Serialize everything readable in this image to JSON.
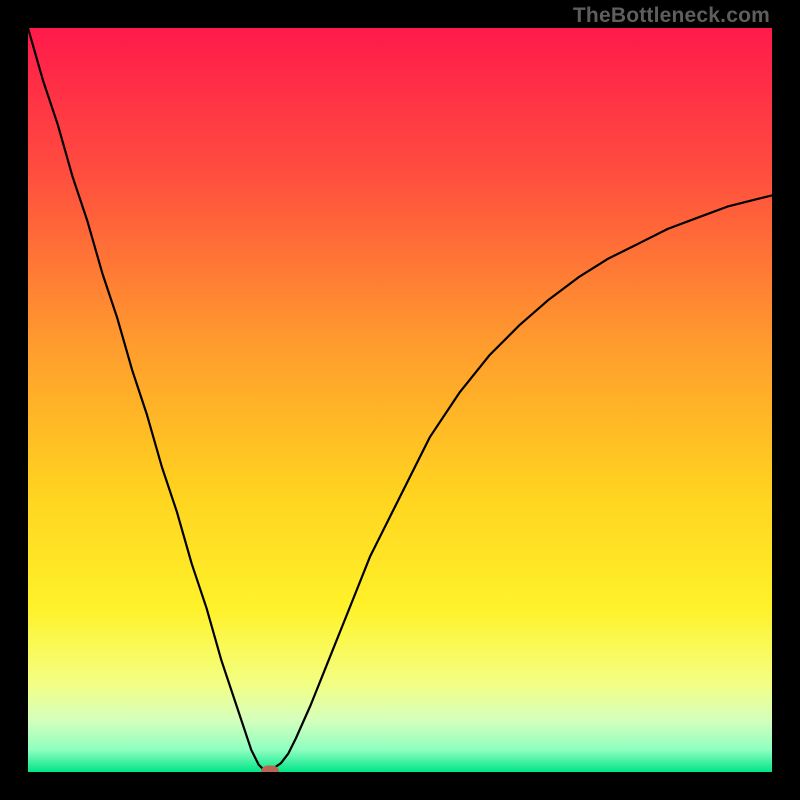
{
  "watermark": {
    "text": "TheBottleneck.com"
  },
  "chart_data": {
    "type": "line",
    "title": "",
    "xlabel": "",
    "ylabel": "",
    "xlim": [
      0,
      100
    ],
    "ylim": [
      0,
      100
    ],
    "grid": false,
    "legend": false,
    "background_gradient": {
      "stops": [
        {
          "pct": 0,
          "color": "#ff1a4b"
        },
        {
          "pct": 20,
          "color": "#ff4f3e"
        },
        {
          "pct": 42,
          "color": "#ff9a2e"
        },
        {
          "pct": 62,
          "color": "#ffd21f"
        },
        {
          "pct": 78,
          "color": "#fff22a"
        },
        {
          "pct": 88,
          "color": "#f4ff82"
        },
        {
          "pct": 93,
          "color": "#d5ffbc"
        },
        {
          "pct": 97,
          "color": "#8fffc0"
        },
        {
          "pct": 100,
          "color": "#00e588"
        }
      ]
    },
    "series": [
      {
        "name": "bottleneck-curve",
        "color": "#000000",
        "width": 2.2,
        "x": [
          0,
          2,
          4,
          6,
          8,
          10,
          12,
          14,
          16,
          18,
          20,
          22,
          24,
          26,
          28,
          30,
          31,
          32,
          33,
          34,
          35,
          36,
          38,
          40,
          42,
          44,
          46,
          48,
          50,
          54,
          58,
          62,
          66,
          70,
          74,
          78,
          82,
          86,
          90,
          94,
          98,
          100
        ],
        "y": [
          100,
          93,
          87,
          80,
          74,
          67,
          61,
          54,
          48,
          41,
          35,
          28,
          22,
          15,
          9,
          3,
          1,
          0,
          0.5,
          1.2,
          2.5,
          4.5,
          9,
          14,
          19,
          24,
          29,
          33,
          37,
          45,
          51,
          56,
          60,
          63.5,
          66.5,
          69,
          71,
          73,
          74.5,
          76,
          77,
          77.5
        ]
      }
    ],
    "marker": {
      "name": "optimal-point",
      "x": 32.5,
      "y": 0,
      "color": "#b96455"
    }
  }
}
